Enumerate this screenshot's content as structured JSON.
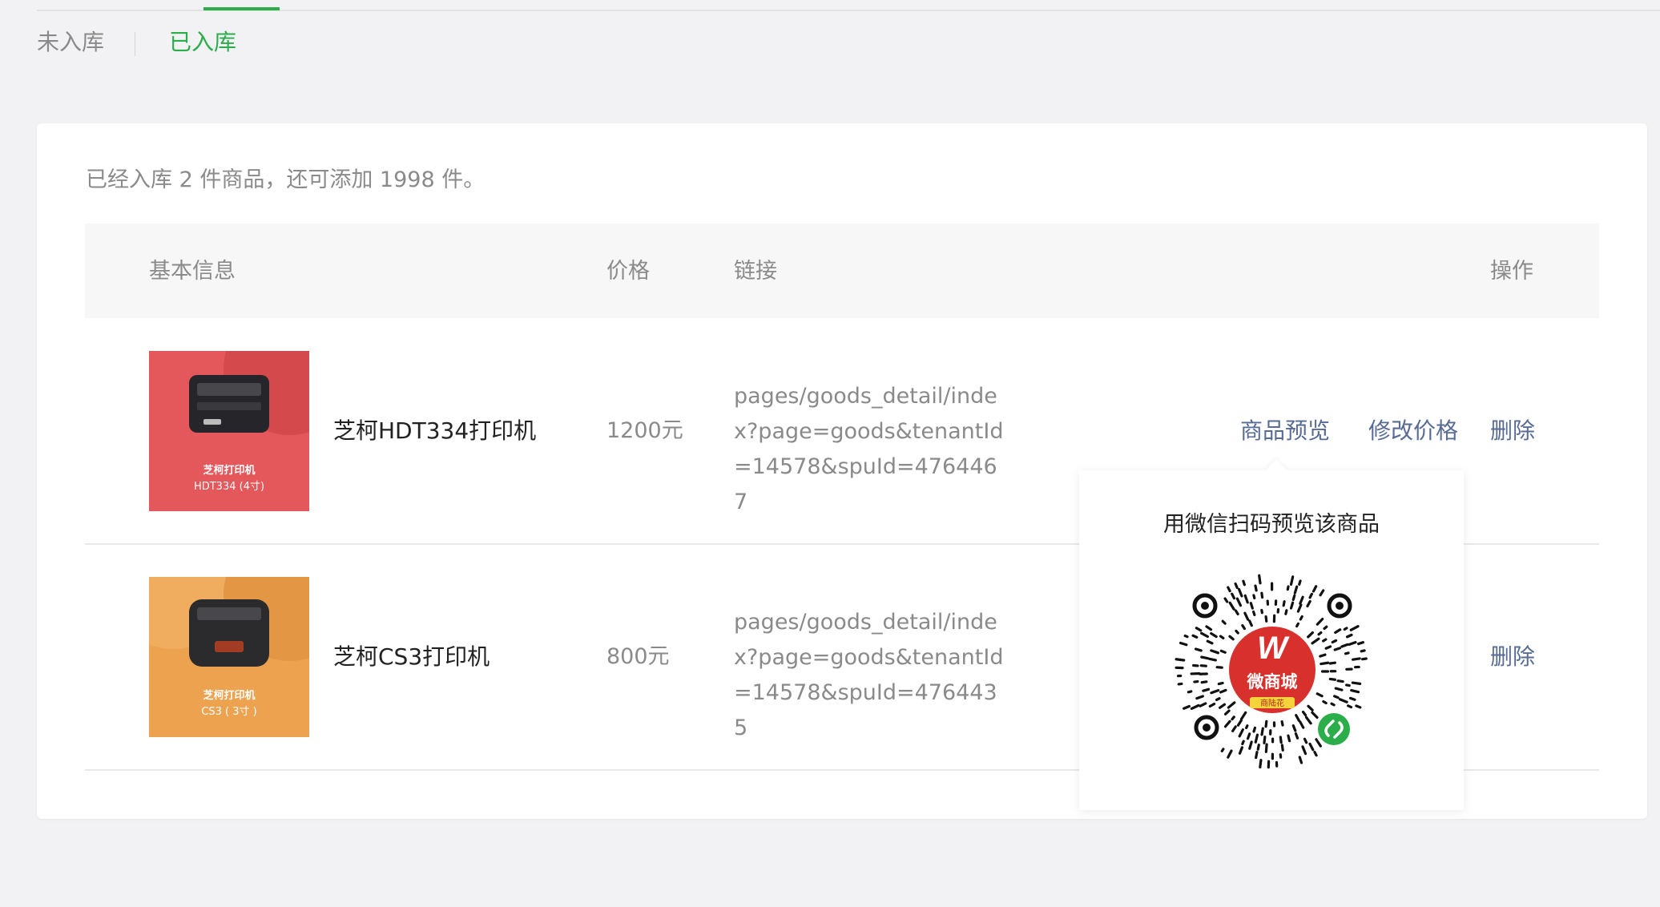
{
  "tabs": [
    {
      "label": "未入库",
      "active": false
    },
    {
      "label": "已入库",
      "active": true
    }
  ],
  "summary": "已经入库 2 件商品，还可添加 1998 件。",
  "table": {
    "headers": {
      "info": "基本信息",
      "price": "价格",
      "link": "链接",
      "actions": "操作"
    },
    "rows": [
      {
        "thumb_caption_1": "芝柯打印机",
        "thumb_caption_2": "HDT334 (4寸)",
        "name": "芝柯HDT334打印机",
        "price": "1200元",
        "link": "pages/goods_detail/index?page=goods&tenantId=14578&spuId=4764467",
        "actions": {
          "preview": "商品预览",
          "edit_price": "修改价格",
          "delete": "删除"
        }
      },
      {
        "thumb_caption_1": "芝柯打印机",
        "thumb_caption_2": "CS3 ( 3寸 )",
        "name": "芝柯CS3打印机",
        "price": "800元",
        "link": "pages/goods_detail/index?page=goods&tenantId=14578&spuId=4764435",
        "actions": {
          "delete": "删除"
        }
      }
    ]
  },
  "popover": {
    "title": "用微信扫码预览该商品",
    "qr_logo_text": "微商城",
    "qr_logo_subtext": "商陆花",
    "qr_logo_mark": "W"
  },
  "colors": {
    "accent_green": "#2bad49",
    "link_blue": "#576b95",
    "thumb_red": "#e4575a",
    "thumb_orange": "#eda24f",
    "qr_logo_red": "#d8312d",
    "mini_program_green": "#2bad49"
  }
}
